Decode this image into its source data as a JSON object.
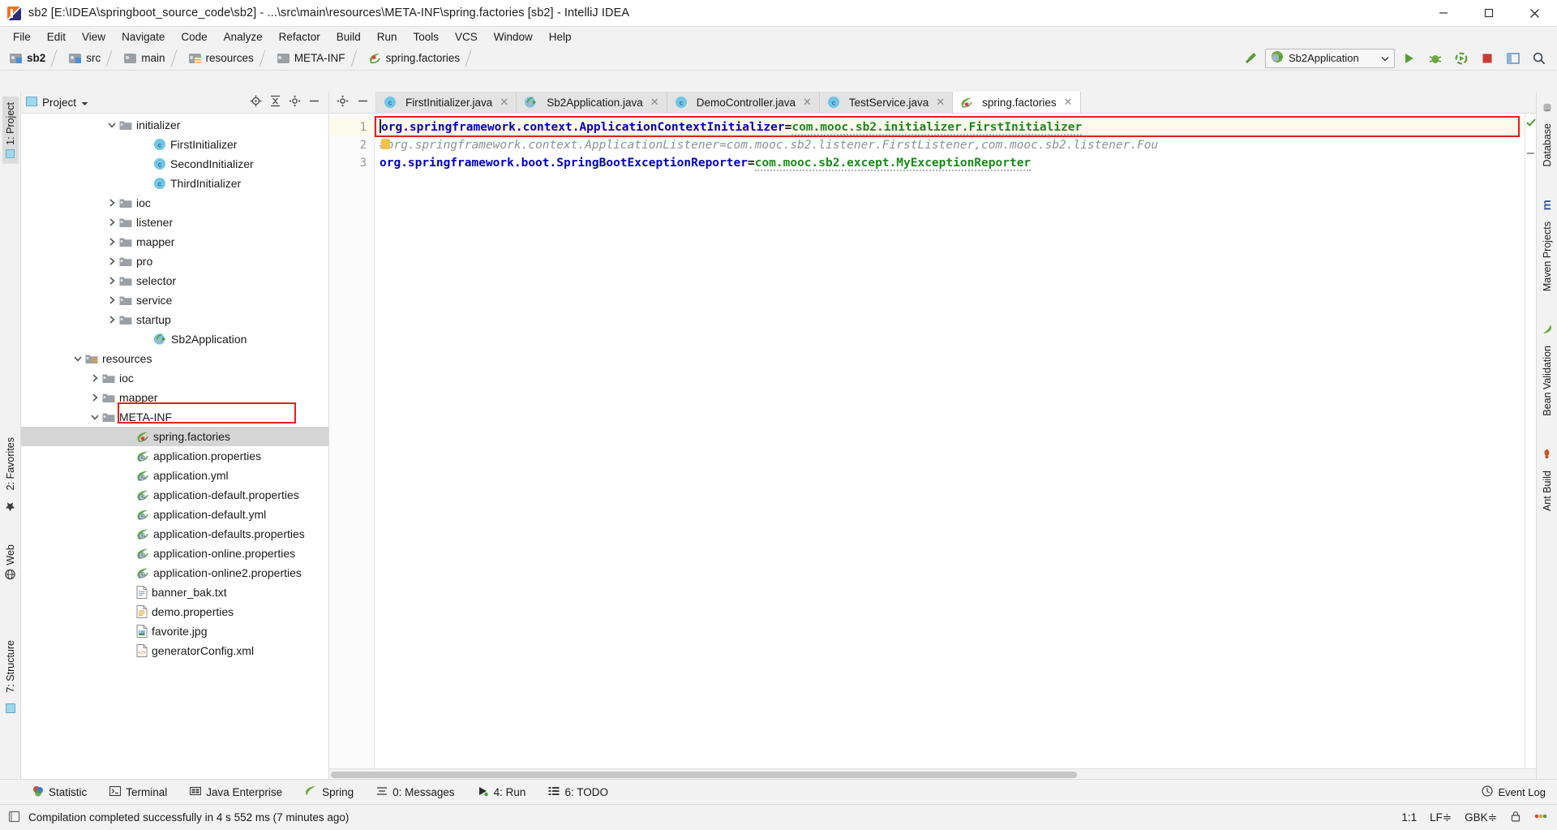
{
  "window": {
    "title": "sb2 [E:\\IDEA\\springboot_source_code\\sb2] - ...\\src\\main\\resources\\META-INF\\spring.factories [sb2] - IntelliJ IDEA",
    "minimize": "–",
    "maximize": "□",
    "close": "✕"
  },
  "menu": {
    "items": [
      {
        "label": "File"
      },
      {
        "label": "Edit"
      },
      {
        "label": "View"
      },
      {
        "label": "Navigate"
      },
      {
        "label": "Code"
      },
      {
        "label": "Analyze"
      },
      {
        "label": "Refactor"
      },
      {
        "label": "Build"
      },
      {
        "label": "Run"
      },
      {
        "label": "Tools"
      },
      {
        "label": "VCS"
      },
      {
        "label": "Window"
      },
      {
        "label": "Help"
      }
    ]
  },
  "navbar": {
    "crumbs": [
      {
        "label": "sb2",
        "icon": "folder-module-icon",
        "bold": true
      },
      {
        "label": "src",
        "icon": "folder-source-icon",
        "bold": false
      },
      {
        "label": "main",
        "icon": "folder-icon",
        "bold": false
      },
      {
        "label": "resources",
        "icon": "folder-resources-icon",
        "bold": false
      },
      {
        "label": "META-INF",
        "icon": "folder-icon",
        "bold": false
      },
      {
        "label": "spring.factories",
        "icon": "spring-factories-icon",
        "bold": false
      }
    ],
    "run_config": "Sb2Application",
    "buttons": {
      "build": "build-hammer-icon",
      "run": "run-icon",
      "debug": "debug-icon",
      "run_coverage": "run-with-coverage-icon",
      "stop": "stop-icon",
      "layout": "layout-icon",
      "search": "search-everywhere-icon"
    }
  },
  "left_rail": {
    "items": [
      {
        "label": "1: Project",
        "active": true
      },
      {
        "label": "2: Favorites",
        "active": false
      },
      {
        "label": "Web",
        "active": false
      },
      {
        "label": "7: Structure",
        "active": false
      }
    ]
  },
  "right_rail": {
    "items": [
      {
        "label": "Database"
      },
      {
        "label": "Maven Projects"
      },
      {
        "label": "Bean Validation"
      },
      {
        "label": "Ant Build"
      }
    ]
  },
  "project_panel": {
    "title": "Project",
    "dropdown_caret": "▾",
    "tools": [
      "locate-icon",
      "collapse-all-icon",
      "settings-gear-icon",
      "hide-minus-icon"
    ],
    "tree": [
      {
        "label": "initializer",
        "indent": 5,
        "arrow": "down",
        "icon": "folder-icon",
        "selected": false
      },
      {
        "label": "FirstInitializer",
        "indent": 7,
        "arrow": "none",
        "icon": "class-icon",
        "selected": false
      },
      {
        "label": "SecondInitializer",
        "indent": 7,
        "arrow": "none",
        "icon": "class-icon",
        "selected": false
      },
      {
        "label": "ThirdInitializer",
        "indent": 7,
        "arrow": "none",
        "icon": "class-icon",
        "selected": false
      },
      {
        "label": "ioc",
        "indent": 5,
        "arrow": "right",
        "icon": "folder-icon",
        "selected": false
      },
      {
        "label": "listener",
        "indent": 5,
        "arrow": "right",
        "icon": "folder-icon",
        "selected": false
      },
      {
        "label": "mapper",
        "indent": 5,
        "arrow": "right",
        "icon": "folder-icon",
        "selected": false
      },
      {
        "label": "pro",
        "indent": 5,
        "arrow": "right",
        "icon": "folder-icon",
        "selected": false
      },
      {
        "label": "selector",
        "indent": 5,
        "arrow": "right",
        "icon": "folder-icon",
        "selected": false
      },
      {
        "label": "service",
        "indent": 5,
        "arrow": "right",
        "icon": "folder-icon",
        "selected": false
      },
      {
        "label": "startup",
        "indent": 5,
        "arrow": "right",
        "icon": "folder-icon",
        "selected": false
      },
      {
        "label": "Sb2Application",
        "indent": 7,
        "arrow": "none",
        "icon": "spring-boot-app-icon",
        "selected": false
      },
      {
        "label": "resources",
        "indent": 3,
        "arrow": "down",
        "icon": "folder-resources-icon",
        "selected": false
      },
      {
        "label": "ioc",
        "indent": 4,
        "arrow": "right",
        "icon": "folder-icon",
        "selected": false
      },
      {
        "label": "mapper",
        "indent": 4,
        "arrow": "right",
        "icon": "folder-icon",
        "selected": false
      },
      {
        "label": "META-INF",
        "indent": 4,
        "arrow": "down",
        "icon": "folder-icon",
        "selected": false
      },
      {
        "label": "spring.factories",
        "indent": 6,
        "arrow": "none",
        "icon": "spring-factories-icon",
        "selected": true
      },
      {
        "label": "application.properties",
        "indent": 6,
        "arrow": "none",
        "icon": "spring-properties-icon",
        "selected": false
      },
      {
        "label": "application.yml",
        "indent": 6,
        "arrow": "none",
        "icon": "spring-properties-icon",
        "selected": false
      },
      {
        "label": "application-default.properties",
        "indent": 6,
        "arrow": "none",
        "icon": "spring-properties-icon",
        "selected": false
      },
      {
        "label": "application-default.yml",
        "indent": 6,
        "arrow": "none",
        "icon": "spring-properties-icon",
        "selected": false
      },
      {
        "label": "application-defaults.properties",
        "indent": 6,
        "arrow": "none",
        "icon": "spring-properties-icon",
        "selected": false
      },
      {
        "label": "application-online.properties",
        "indent": 6,
        "arrow": "none",
        "icon": "spring-properties-icon",
        "selected": false
      },
      {
        "label": "application-online2.properties",
        "indent": 6,
        "arrow": "none",
        "icon": "spring-properties-icon",
        "selected": false
      },
      {
        "label": "banner_bak.txt",
        "indent": 6,
        "arrow": "none",
        "icon": "text-file-icon",
        "selected": false
      },
      {
        "label": "demo.properties",
        "indent": 6,
        "arrow": "none",
        "icon": "properties-file-icon",
        "selected": false
      },
      {
        "label": "favorite.jpg",
        "indent": 6,
        "arrow": "none",
        "icon": "image-file-icon",
        "selected": false
      },
      {
        "label": "generatorConfig.xml",
        "indent": 6,
        "arrow": "none",
        "icon": "xml-file-icon",
        "selected": false
      }
    ]
  },
  "editor": {
    "tabs": [
      {
        "label": "FirstInitializer.java",
        "icon": "java-class-icon",
        "active": false,
        "close": "✕"
      },
      {
        "label": "Sb2Application.java",
        "icon": "spring-boot-app-icon",
        "active": false,
        "close": "✕"
      },
      {
        "label": "DemoController.java",
        "icon": "java-class-icon",
        "active": false,
        "close": "✕"
      },
      {
        "label": "TestService.java",
        "icon": "java-class-icon",
        "active": false,
        "close": "✕"
      },
      {
        "label": "spring.factories",
        "icon": "spring-factories-icon",
        "active": true,
        "close": "✕"
      }
    ],
    "line_numbers": [
      "1",
      "2",
      "3"
    ],
    "lines": [
      {
        "number": "1",
        "current": true,
        "comment": false,
        "key": "org.springframework.context.ApplicationContextInitializer",
        "eq": "=",
        "value": "com.mooc.sb2.initializer.FirstInitializer"
      },
      {
        "number": "2",
        "current": false,
        "comment": true,
        "text": "#org.springframework.context.ApplicationListener=com.mooc.sb2.listener.FirstListener,com.mooc.sb2.listener.Fou"
      },
      {
        "number": "3",
        "current": false,
        "comment": false,
        "key": "org.springframework.boot.SpringBootExceptionReporter",
        "eq": "=",
        "value": "com.mooc.sb2.except.MyExceptionReporter"
      }
    ]
  },
  "bottom_toolwindows": {
    "items": [
      {
        "label": "Statistic",
        "icon": "statistic-icon",
        "mnemonic": ""
      },
      {
        "label": "Terminal",
        "icon": "terminal-icon",
        "mnemonic": ""
      },
      {
        "label": "Java Enterprise",
        "icon": "java-enterprise-icon",
        "mnemonic": ""
      },
      {
        "label": "Spring",
        "icon": "spring-leaf-icon",
        "mnemonic": ""
      },
      {
        "label": "0: Messages",
        "icon": "messages-icon",
        "mnemonic": "0"
      },
      {
        "label": "4: Run",
        "icon": "run-icon",
        "mnemonic": "4"
      },
      {
        "label": "6: TODO",
        "icon": "todo-icon",
        "mnemonic": "6"
      }
    ],
    "event_log": "Event Log"
  },
  "statusbar": {
    "message": "Compilation completed successfully in 4 s 552 ms (7 minutes ago)",
    "message_icon": "build-status-icon",
    "caret_position": "1:1",
    "line_separator": "LF",
    "line_separator_caret": "≑",
    "encoding": "GBK",
    "encoding_caret": "≑",
    "lock_icon": "read-only-lock-icon",
    "inspections_icon": "inspections-icon"
  },
  "colors": {
    "accent_red": "#e81c1c",
    "key_blue": "#0000c0",
    "value_green": "#1a8a1a",
    "comment_gray": "#909090",
    "selection_gray": "#d5d5d5",
    "current_line": "#fcfaeb"
  }
}
